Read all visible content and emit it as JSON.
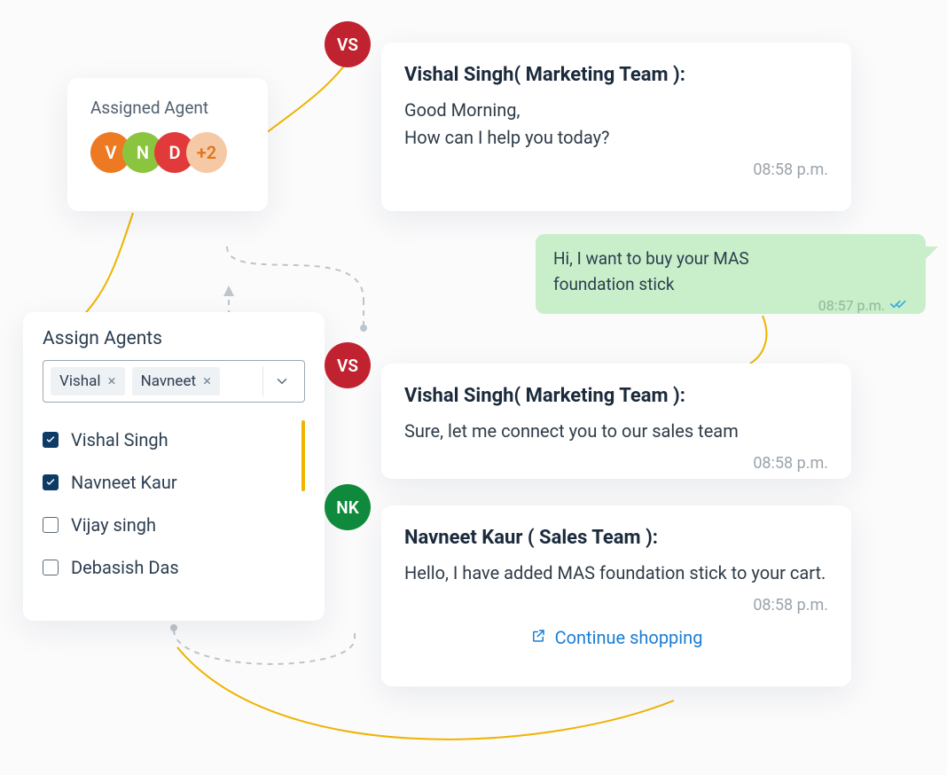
{
  "assigned": {
    "title": "Assigned Agent",
    "avatars": [
      "V",
      "N",
      "D"
    ],
    "more": "+2"
  },
  "assign": {
    "title": "Assign Agents",
    "chips": [
      "Vishal",
      "Navneet"
    ],
    "options": [
      {
        "checked": true,
        "label": "Vishal Singh"
      },
      {
        "checked": true,
        "label": "Navneet Kaur"
      },
      {
        "checked": false,
        "label": "Vijay singh"
      },
      {
        "checked": false,
        "label": "Debasish Das"
      }
    ]
  },
  "chat": {
    "messages": [
      {
        "avatar": "VS",
        "who": "Vishal Singh( Marketing Team ):",
        "body_line1": "Good Morning,",
        "body_line2": "How can I help you today?",
        "time": "08:58 p.m."
      },
      {
        "avatar": "VS",
        "who": "Vishal Singh( Marketing Team ):",
        "body_line1": "Sure, let me connect you to our sales team",
        "body_line2": "",
        "time": "08:58 p.m."
      },
      {
        "avatar": "NK",
        "who": "Navneet Kaur ( Sales Team ):",
        "body_line1": "Hello, I have added MAS foundation stick to your cart.",
        "body_line2": "",
        "time": "08:58 p.m.",
        "cta": "Continue shopping"
      }
    ],
    "user": {
      "text_line1": "Hi, I want to buy your  MAS",
      "text_line2": "foundation stick",
      "time": "08:57 p.m."
    }
  },
  "icons": {
    "checks": "double-check-icon"
  }
}
